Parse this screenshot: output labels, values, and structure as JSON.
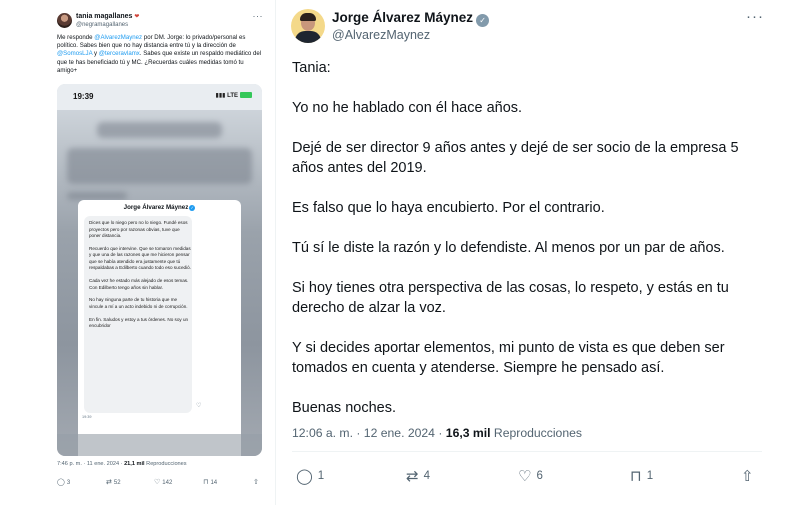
{
  "left_tweet": {
    "author_name": "tania magallanes",
    "author_emoji": "❤",
    "handle": "@negramagallanes",
    "more": "···",
    "text_parts": {
      "p1": "Me responde ",
      "m1": "@AlvarezMaynez",
      "p2": " por DM. Jorge: lo privado/personal es político. Sabes bien que no hay distancia entre tú y la dirección de ",
      "m2": "@SomosLJA",
      "p3": " y ",
      "m3": "@terceravlamx",
      "p4": ". Sabes que existe un respaldo mediático del que te has beneficiado tú y MC. ¿Recuerdas cuáles medidas tomó tu amigo+"
    },
    "phone": {
      "time": "19:39",
      "signal": "LTE",
      "modal_title": "Jorge Álvarez Máynez",
      "dm_paragraphs": [
        "Dices que lo niego pero no lo niego. Fundé esos proyectos pero por razonas obvias, tuve que poner distancia.",
        "Recuerdo que intervine. Que se tomaron medidas y que una de las razones que me hicieron pensar que se había atendido era justamente que tú respaldabas a Edilberto cuando todo eso sucedió.",
        "Cada vez he estado más alejado de esos temas. Con Edilberto tengo años sin hablar.",
        "No hay ninguna parte de tu historia que me vincule a mí a un acto indebido ni de corrupción.",
        "En fin. Saludos y estoy a tus órdenes. No soy un encubridor"
      ],
      "dm_time": "19:39"
    },
    "meta": {
      "time_date": "7:46 p. m. · 11 ene. 2024 · ",
      "views": "21,1 mil",
      "views_label": " Reproducciones"
    },
    "actions": {
      "replies": "3",
      "reposts": "52",
      "likes": "142",
      "bookmarks": "14"
    }
  },
  "right_tweet": {
    "author_name": "Jorge Álvarez Máynez",
    "handle": "@AlvarezMaynez",
    "more": "···",
    "paragraphs": [
      "Tania:",
      "Yo no he hablado con él hace años.",
      "Dejé de ser director 9 años antes y dejé de ser socio de la empresa 5 años antes del 2019.",
      "Es falso que lo haya encubierto. Por el contrario.",
      "Tú sí le diste la razón y lo defendiste. Al menos por un par de años.",
      "Si hoy tienes otra perspectiva de las cosas, lo respeto, y estás en tu derecho de alzar la voz.",
      "Y si decides aportar elementos, mi punto de vista es que deben ser tomados en cuenta y atenderse. Siempre he pensado así.",
      "Buenas noches."
    ],
    "meta": {
      "time_date": "12:06 a. m. · 12 ene. 2024 · ",
      "views": "16,3 mil",
      "views_label": " Reproducciones"
    },
    "actions": {
      "replies": "1",
      "reposts": "4",
      "likes": "6",
      "bookmarks": "1"
    }
  },
  "colors": {
    "text": "#0f1419",
    "secondary": "#536471",
    "link": "#1d9bf0",
    "badge_gray": "#829aab",
    "divider": "#eff3f4"
  },
  "icons": [
    "reply-icon",
    "repost-icon",
    "like-icon",
    "bookmark-icon",
    "share-icon",
    "verified-badge-icon",
    "more-icon"
  ]
}
